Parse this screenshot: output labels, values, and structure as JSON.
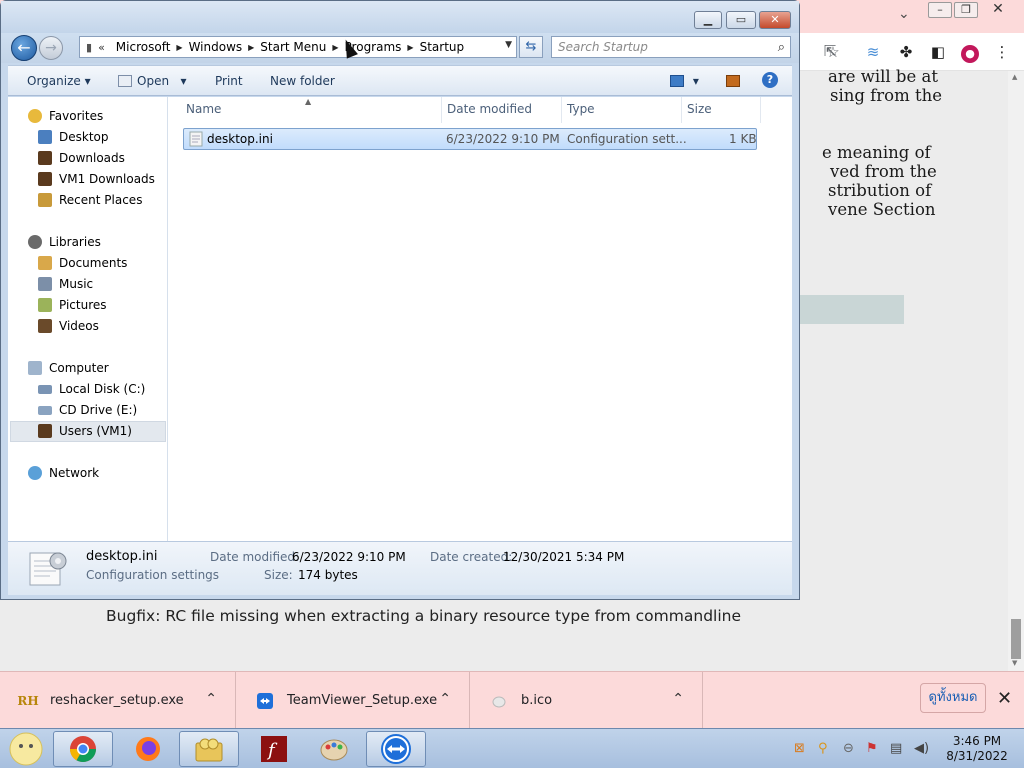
{
  "browser": {
    "doc_lines": [
      "are will be at",
      "sing from the",
      "e meaning of",
      "ved from the",
      "stribution of",
      "vene Section"
    ],
    "bugfix_text": "Bugfix:  RC file missing when extracting a binary resource type from commandline"
  },
  "downloads": {
    "items": [
      {
        "name": "reshacker_setup.exe",
        "icon": "reshacker-icon"
      },
      {
        "name": "TeamViewer_Setup.exe",
        "icon": "teamviewer-icon"
      },
      {
        "name": "b.ico",
        "icon": "file-icon"
      }
    ],
    "show_all_label": "ดูทั้งหมด"
  },
  "explorer": {
    "breadcrumb": [
      "Microsoft",
      "Windows",
      "Start Menu",
      "Programs",
      "Startup"
    ],
    "search_placeholder": "Search Startup",
    "commands": {
      "organize": "Organize",
      "open": "Open",
      "print": "Print",
      "new_folder": "New folder"
    },
    "nav": {
      "favorites": "Favorites",
      "desktop": "Desktop",
      "downloads": "Downloads",
      "vm1_downloads": "VM1 Downloads",
      "recent_places": "Recent Places",
      "libraries": "Libraries",
      "documents": "Documents",
      "music": "Music",
      "pictures": "Pictures",
      "videos": "Videos",
      "computer": "Computer",
      "local_disk": "Local Disk (C:)",
      "cd_drive": "CD Drive (E:)",
      "users": "Users (VM1)",
      "network": "Network"
    },
    "columns": {
      "name": "Name",
      "date_modified": "Date modified",
      "type": "Type",
      "size": "Size"
    },
    "files": [
      {
        "name": "desktop.ini",
        "date_modified": "6/23/2022 9:10 PM",
        "type": "Configuration sett...",
        "size": "1 KB"
      }
    ],
    "details": {
      "file_name": "desktop.ini",
      "file_type": "Configuration settings",
      "date_modified_label": "Date modified:",
      "date_modified_value": "6/23/2022 9:10 PM",
      "date_created_label": "Date created:",
      "date_created_value": "12/30/2021 5:34 PM",
      "size_label": "Size:",
      "size_value": "174 bytes"
    }
  },
  "taskbar": {
    "time": "3:46 PM",
    "date": "8/31/2022"
  },
  "colors": {
    "chrome_pink": "#fcdada",
    "explorer_frame": "#c7d8ec",
    "selection": "#c1dcfc",
    "link_blue": "#1a5fb4"
  }
}
